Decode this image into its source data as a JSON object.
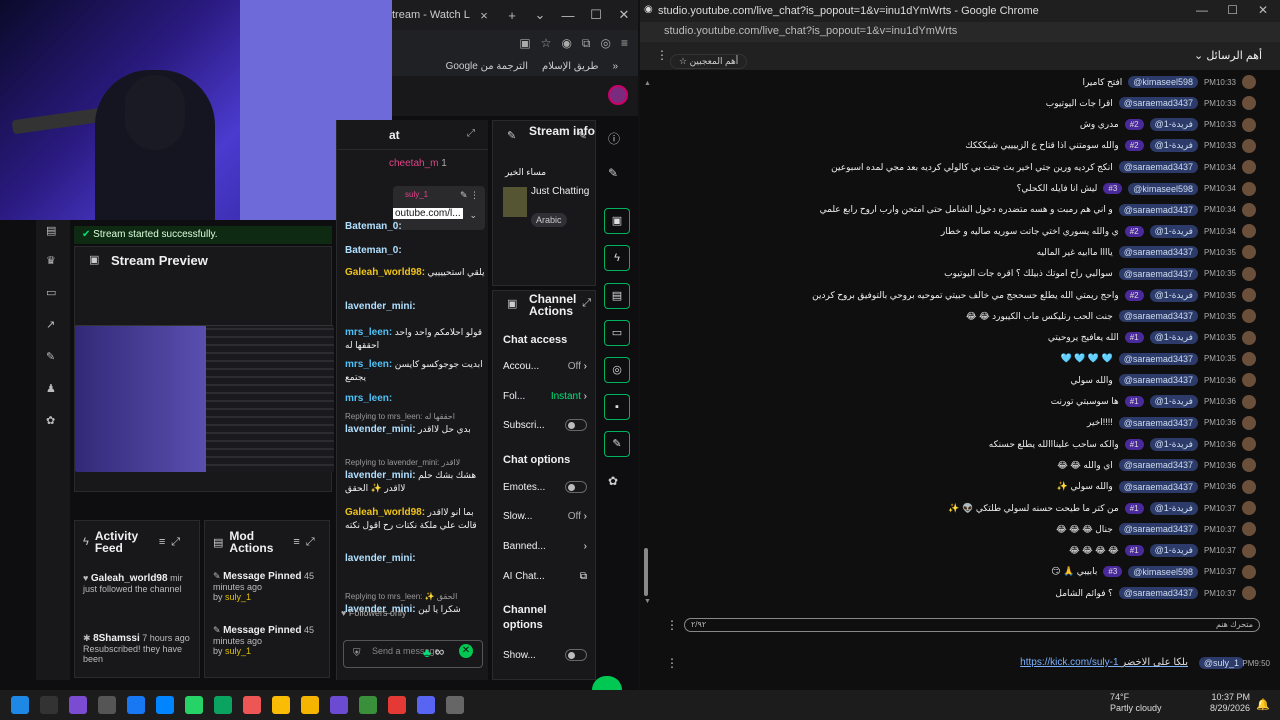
{
  "left_browser": {
    "tab_title": "tream - Watch L",
    "bookmarks": [
      "Google الترجمة من",
      "طريق الإسلام"
    ]
  },
  "dashboard": {
    "success_message": "Stream started successfully.",
    "stream_preview": {
      "title": "Stream Preview"
    },
    "activity_feed": {
      "title": "Activity Feed",
      "items": [
        {
          "user": "Galeah_world98",
          "text": "just followed the channel",
          "time": "mir"
        },
        {
          "user": "8Shamssi",
          "text": "Resubscribed! they have been",
          "time": "7 hours ago"
        }
      ]
    },
    "mod_actions": {
      "title": "Mod Actions",
      "items": [
        {
          "action": "Message Pinned",
          "by": "by",
          "user": "suly_1",
          "time": "45 minutes ago"
        },
        {
          "action": "Message Pinned",
          "by": "by",
          "user": "suly_1",
          "time": "45 minutes ago"
        }
      ]
    },
    "chat": {
      "title": "at",
      "pinned_user": "cheetah_m",
      "pinned_count": "1",
      "popup_user": "suly_1",
      "popup_link": "outube.com/l...",
      "messages": [
        {
          "user": "Bateman_0:",
          "text": ""
        },
        {
          "user": "Bateman_0:",
          "text": ""
        },
        {
          "user": "Galeah_world98:",
          "text": "يلقي استحييييي"
        },
        {
          "user": "lavender_mini:",
          "text": ""
        },
        {
          "user": "mrs_leen:",
          "text": "قولو احلامكم واحد واحد احققها له"
        },
        {
          "user": "mrs_leen:",
          "text": "ابديت جوجوكسو كايسن يجتمع"
        },
        {
          "user": "mrs_leen:",
          "text": ""
        },
        {
          "user": "lavender_mini:",
          "text": "بدي حل لااقدر",
          "reply": "Replying to mrs_leen: احققها له"
        },
        {
          "user": "lavender_mini:",
          "text": "هشك بشك حلم لااقدر ✨ الحقق",
          "reply": "Replying to lavender_mini: لااقدر"
        },
        {
          "user": "Galeah_world98:",
          "text": "بما انو لااقدر قالت علي ملكة نكتات رح اقول نكته"
        },
        {
          "user": "lavender_mini:",
          "text": ""
        },
        {
          "user": "lavender_mini:",
          "text": "شكرا يا لين",
          "reply": "Replying to mrs_leen: ✨ الحقق"
        }
      ],
      "followers_only": "Followers only",
      "send_placeholder": "Send a message",
      "chat_footer_icons": "∞"
    },
    "stream_info": {
      "title": "Stream info",
      "stream_title": "مساء الخير",
      "category": "Just Chatting",
      "tag": "Arabic"
    },
    "channel_actions": {
      "title": "Channel Actions",
      "chat_access": "Chat access",
      "rows_access": [
        {
          "label": "Accou...",
          "value": "Off"
        },
        {
          "label": "Fol...",
          "value": "Instant"
        },
        {
          "label": "Subscri...",
          "value": ""
        }
      ],
      "chat_options": "Chat options",
      "rows_options": [
        {
          "label": "Emotes...",
          "value": ""
        },
        {
          "label": "Slow...",
          "value": "Off"
        },
        {
          "label": "Banned...",
          "value": ""
        },
        {
          "label": "AI Chat...",
          "value": ""
        }
      ],
      "channel_options": "Channel options",
      "show_label": "Show..."
    }
  },
  "popout": {
    "window_title": "studio.youtube.com/live_chat?is_popout=1&v=inu1dYmWrts - Google Chrome",
    "address": "studio.youtube.com/live_chat?is_popout=1&v=inu1dYmWrts",
    "header": "أهم الرسائل",
    "chip": "أهم المعجبين",
    "messages": [
      {
        "time": "PM10:33",
        "name": "@kimaseel598",
        "badge": "",
        "text": "افتح كاميرا"
      },
      {
        "time": "PM10:33",
        "name": "@saraemad3437",
        "badge": "",
        "text": "اقرا جات اليوتيوب"
      },
      {
        "time": "PM10:33",
        "name": "@فريدة-1",
        "badge": "#2",
        "text": "مدري وش"
      },
      {
        "time": "PM10:33",
        "name": "@فريدة-1",
        "badge": "#2",
        "text": "والله سومتني اذا قتاح ع الزييييي شيكككك"
      },
      {
        "time": "PM10:34",
        "name": "@saraemad3437",
        "badge": "",
        "text": "انكج كرديه ورين جتي اخير بث جتت بي كالولي كرديه بعد مجي لمده اسبوعين"
      },
      {
        "time": "PM10:34",
        "name": "@kimaseel598",
        "badge": "#3",
        "text": "ليش انا فايله الكحلي؟"
      },
      {
        "time": "PM10:34",
        "name": "@saraemad3437",
        "badge": "",
        "text": "و اني هم رمبت و هسه متضدره دخول الشامل حتى امتحن وارب اروح رابع علمي"
      },
      {
        "time": "PM10:34",
        "name": "@فريدة-1",
        "badge": "#2",
        "text": "ي والله يسوري اختي جاتت سوريه صاليه و خطار"
      },
      {
        "time": "PM10:35",
        "name": "@saraemad3437",
        "badge": "",
        "text": "ياااا ماابيه غير الماليه"
      },
      {
        "time": "PM10:35",
        "name": "@saraemad3437",
        "badge": "",
        "text": "سوالبي راح اموتك ذبيلك ؟ اقره جات اليوتيوب"
      },
      {
        "time": "PM10:35",
        "name": "@فريدة-1",
        "badge": "#2",
        "text": "واحج ريمتي الله يطلع حسحجج مي خالف حبيتي تموحيه بروحي بالتوفيق بروح كردين"
      },
      {
        "time": "PM10:35",
        "name": "@saraemad3437",
        "badge": "",
        "text": "😂 😂 جنت الحب رتليكس ماب الكيبورد"
      },
      {
        "time": "PM10:35",
        "name": "@فريدة-1",
        "badge": "#1",
        "text": "الله يعافيج يروحيتي"
      },
      {
        "time": "PM10:35",
        "name": "@saraemad3437",
        "badge": "",
        "text": "🩵 🩵 🩵 🩵"
      },
      {
        "time": "PM10:36",
        "name": "@saraemad3437",
        "badge": "",
        "text": "والله سولي"
      },
      {
        "time": "PM10:36",
        "name": "@فريدة-1",
        "badge": "#1",
        "text": "ها سوسبتي تورنت"
      },
      {
        "time": "PM10:36",
        "name": "@saraemad3437",
        "badge": "",
        "text": "اخير!!!!"
      },
      {
        "time": "PM10:36",
        "name": "@فريدة-1",
        "badge": "#1",
        "text": "والكه ساحب علينااالله يطلع حسنكه"
      },
      {
        "time": "PM10:36",
        "name": "@saraemad3437",
        "badge": "",
        "text": "😂 😂 اي والله"
      },
      {
        "time": "PM10:36",
        "name": "@saraemad3437",
        "badge": "",
        "text": "✨ والله سولي"
      },
      {
        "time": "PM10:37",
        "name": "@فريدة-1",
        "badge": "#1",
        "text": "✨ 👽 من كتر ما طيحت حسنه لسولي طلتكي"
      },
      {
        "time": "PM10:37",
        "name": "@saraemad3437",
        "badge": "",
        "text": "😂 😂 😂 جنال"
      },
      {
        "time": "PM10:37",
        "name": "@فريدة-1",
        "badge": "#1",
        "text": "😂 😂 😂 😂"
      },
      {
        "time": "PM10:37",
        "name": "@kimaseel598",
        "badge": "#3",
        "text": "😏 🙏 بابيبي"
      },
      {
        "time": "PM10:37",
        "name": "@saraemad3437",
        "badge": "",
        "text": "؟ فوائم الشامل"
      }
    ],
    "input_hint": "متحرك هنم",
    "input_count": "٢/٩٢",
    "pinned_time": "PM9:50",
    "pinned_user": "@suly_1",
    "pinned_text": "بلكا على الاخضر",
    "pinned_link": "https://kick.com/suly-1"
  },
  "taskbar": {
    "temperature": "74°F",
    "weather": "Partly cloudy",
    "time": "10:37 PM",
    "date": "8/29/2026"
  }
}
